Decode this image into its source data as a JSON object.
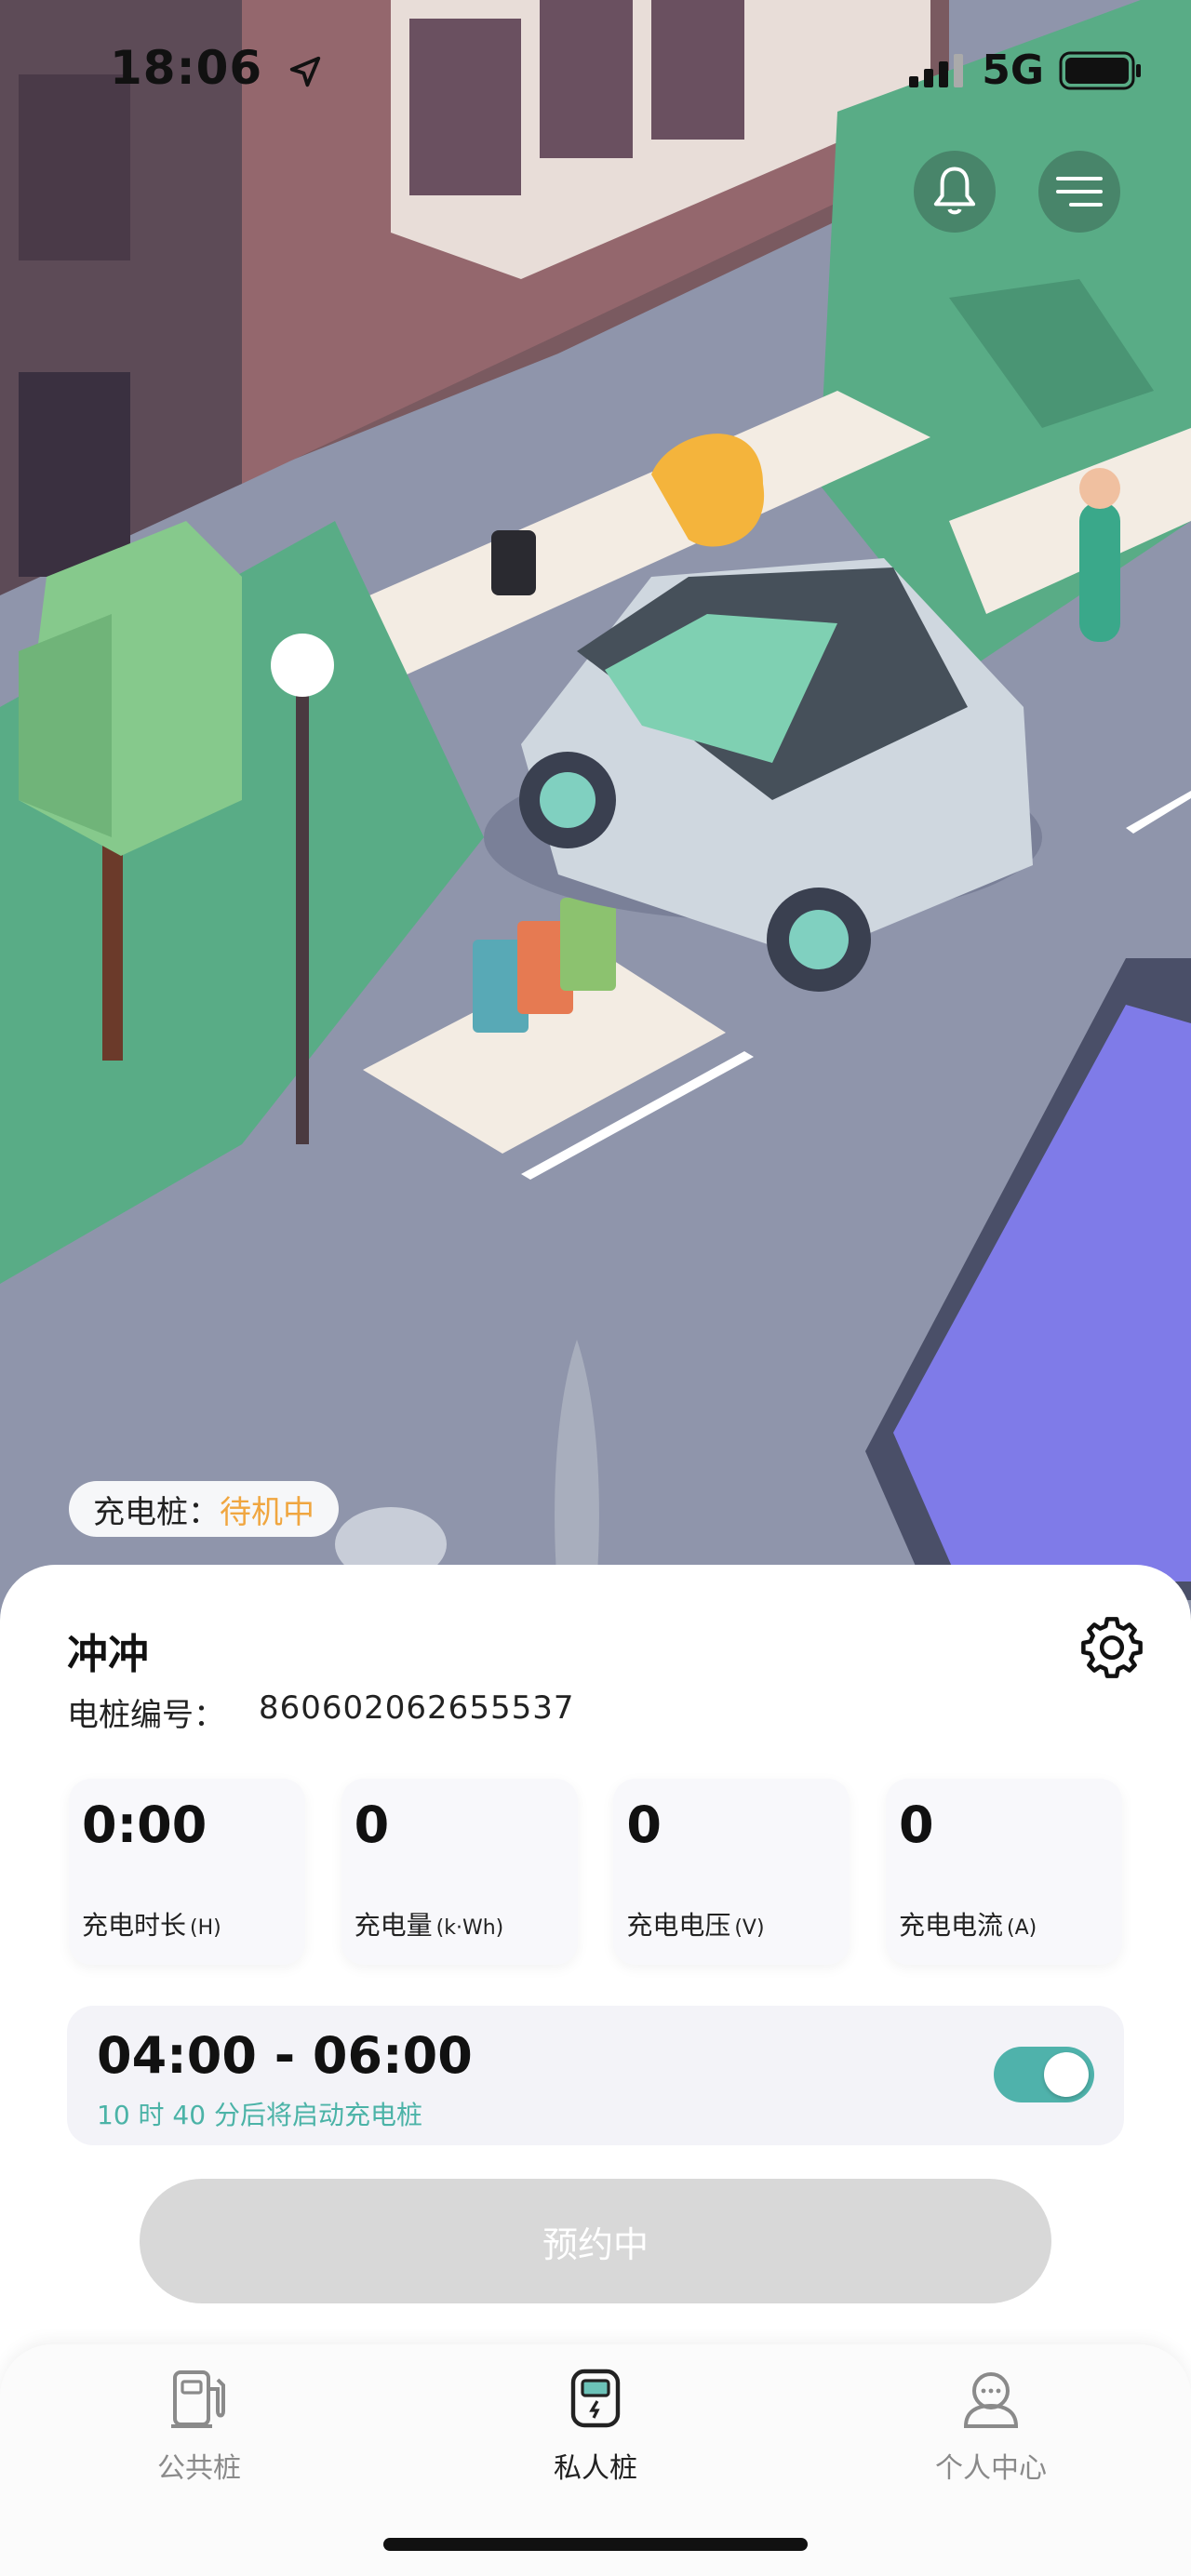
{
  "status_bar": {
    "time": "18:06",
    "network": "5G"
  },
  "charger_status": {
    "label": "充电桩：",
    "state": "待机中",
    "state_color": "#f0a640"
  },
  "device": {
    "name": "冲冲",
    "serial_label": "电桩编号：",
    "serial_value": "860602062655537"
  },
  "stats": [
    {
      "value": "0:00",
      "label": "充电时长",
      "unit": "(H)"
    },
    {
      "value": "0",
      "label": "充电量",
      "unit": "(k·Wh)"
    },
    {
      "value": "0",
      "label": "充电电压",
      "unit": "(V)"
    },
    {
      "value": "0",
      "label": "充电电流",
      "unit": "(A)"
    }
  ],
  "schedule": {
    "time_range": "04:00 - 06:00",
    "hint": "10 时 40 分后将启动充电桩",
    "enabled": true
  },
  "reserve_button": {
    "label": "预约中"
  },
  "tabs": [
    {
      "label": "公共桩",
      "icon": "gas-pump-icon",
      "active": false
    },
    {
      "label": "私人桩",
      "icon": "charger-device-icon",
      "active": true
    },
    {
      "label": "个人中心",
      "icon": "user-chat-icon",
      "active": false
    }
  ],
  "colors": {
    "accent": "#4fb2ab",
    "status_orange": "#f0a640",
    "button_disabled": "#d8d8d8"
  }
}
